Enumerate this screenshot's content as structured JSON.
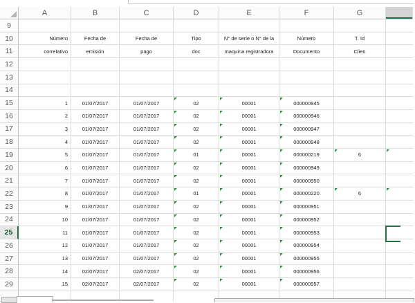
{
  "grid": {
    "column_letters": [
      "A",
      "B",
      "C",
      "D",
      "E",
      "F",
      "G"
    ],
    "row_numbers": [
      "9",
      "10",
      "11",
      "12",
      "13",
      "14",
      "15",
      "16",
      "17",
      "18",
      "19",
      "20",
      "21",
      "22",
      "23",
      "24",
      "25",
      "26",
      "27",
      "28",
      "29"
    ],
    "header_labels": {
      "A": [
        "Número",
        "correlativo"
      ],
      "B": [
        "Fecha de",
        "emisión"
      ],
      "C": [
        "Fecha de",
        "pago"
      ],
      "D": [
        "Tipo",
        "doc"
      ],
      "E": [
        "N° de serie o N° de la",
        "maquina registradora"
      ],
      "F": [
        "Número",
        "Documento"
      ],
      "G": [
        "T. Id",
        "Clien"
      ]
    },
    "rows": [
      {
        "row": "15",
        "correlativo": "1",
        "emision": "01/07/2017",
        "pago": "01/07/2017",
        "tipo": "02",
        "serie": "00001",
        "documento": "000000945",
        "tid": "",
        "marks": [
          "tipo",
          "serie",
          "documento"
        ]
      },
      {
        "row": "16",
        "correlativo": "2",
        "emision": "01/07/2017",
        "pago": "01/07/2017",
        "tipo": "02",
        "serie": "00001",
        "documento": "000000946",
        "tid": "",
        "marks": [
          "tipo",
          "serie",
          "documento"
        ]
      },
      {
        "row": "17",
        "correlativo": "3",
        "emision": "01/07/2017",
        "pago": "01/07/2017",
        "tipo": "02",
        "serie": "00001",
        "documento": "000000947",
        "tid": "",
        "marks": [
          "tipo",
          "serie",
          "documento"
        ]
      },
      {
        "row": "18",
        "correlativo": "4",
        "emision": "01/07/2017",
        "pago": "01/07/2017",
        "tipo": "02",
        "serie": "00001",
        "documento": "000000948",
        "tid": "",
        "marks": [
          "tipo",
          "serie",
          "documento"
        ]
      },
      {
        "row": "19",
        "correlativo": "5",
        "emision": "01/07/2017",
        "pago": "01/07/2017",
        "tipo": "01",
        "serie": "00001",
        "documento": "000000219",
        "tid": "6",
        "marks": [
          "tipo",
          "serie",
          "documento",
          "tid",
          "next"
        ]
      },
      {
        "row": "20",
        "correlativo": "6",
        "emision": "01/07/2017",
        "pago": "01/07/2017",
        "tipo": "02",
        "serie": "00001",
        "documento": "000000949",
        "tid": "",
        "marks": [
          "tipo",
          "serie",
          "documento"
        ]
      },
      {
        "row": "21",
        "correlativo": "7",
        "emision": "01/07/2017",
        "pago": "01/07/2017",
        "tipo": "02",
        "serie": "00001",
        "documento": "000000950",
        "tid": "",
        "marks": [
          "tipo",
          "serie",
          "documento"
        ]
      },
      {
        "row": "22",
        "correlativo": "8",
        "emision": "01/07/2017",
        "pago": "01/07/2017",
        "tipo": "01",
        "serie": "00001",
        "documento": "000000220",
        "tid": "6",
        "marks": [
          "tipo",
          "serie",
          "documento",
          "tid",
          "next"
        ]
      },
      {
        "row": "23",
        "correlativo": "9",
        "emision": "01/07/2017",
        "pago": "01/07/2017",
        "tipo": "02",
        "serie": "00001",
        "documento": "000000951",
        "tid": "",
        "marks": [
          "tipo",
          "serie",
          "documento"
        ]
      },
      {
        "row": "24",
        "correlativo": "10",
        "emision": "01/07/2017",
        "pago": "01/07/2017",
        "tipo": "02",
        "serie": "00001",
        "documento": "000000952",
        "tid": "",
        "marks": [
          "tipo",
          "serie",
          "documento"
        ]
      },
      {
        "row": "25",
        "correlativo": "11",
        "emision": "01/07/2017",
        "pago": "01/07/2017",
        "tipo": "02",
        "serie": "00001",
        "documento": "000000953",
        "tid": "",
        "marks": [
          "tipo",
          "serie",
          "documento"
        ]
      },
      {
        "row": "26",
        "correlativo": "12",
        "emision": "01/07/2017",
        "pago": "01/07/2017",
        "tipo": "02",
        "serie": "00001",
        "documento": "000000954",
        "tid": "",
        "marks": [
          "tipo",
          "serie",
          "documento"
        ]
      },
      {
        "row": "27",
        "correlativo": "13",
        "emision": "01/07/2017",
        "pago": "01/07/2017",
        "tipo": "02",
        "serie": "00001",
        "documento": "000000955",
        "tid": "",
        "marks": [
          "tipo",
          "serie",
          "documento"
        ]
      },
      {
        "row": "28",
        "correlativo": "14",
        "emision": "02/07/2017",
        "pago": "02/07/2017",
        "tipo": "02",
        "serie": "00001",
        "documento": "000000956",
        "tid": "",
        "marks": [
          "tipo",
          "serie",
          "documento"
        ]
      },
      {
        "row": "29",
        "correlativo": "15",
        "emision": "02/07/2017",
        "pago": "02/07/2017",
        "tipo": "02",
        "serie": "00001",
        "documento": "000000957",
        "tid": "",
        "marks": [
          "tipo",
          "serie",
          "documento"
        ]
      }
    ],
    "selection": {
      "active_row": "25",
      "active_cell_column": "H"
    },
    "colors": {
      "selection_green": "#217346",
      "error_indicator_green": "#279043"
    }
  }
}
